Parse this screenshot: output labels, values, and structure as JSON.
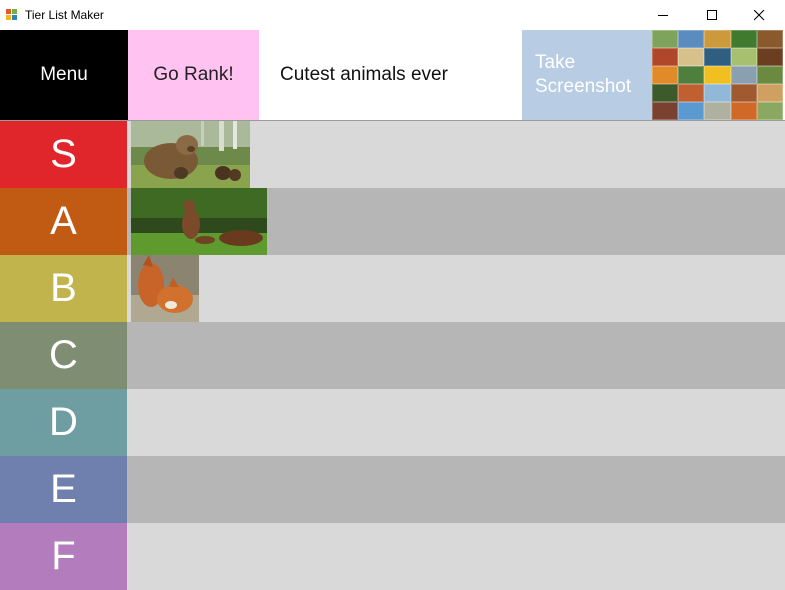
{
  "window": {
    "title": "Tier List Maker",
    "controls": [
      "minimize",
      "maximize",
      "close"
    ]
  },
  "toolbar": {
    "menu_label": "Menu",
    "rank_label": "Go Rank!",
    "list_title": "Cutest animals ever",
    "screenshot_line1": "Take",
    "screenshot_line2": "Screenshot"
  },
  "colors": {
    "menu_bg": "#000000",
    "rank_bg": "#ffc2f1",
    "screenshot_bg": "#b8cce4",
    "row_light": "#d9d9d9",
    "row_dark": "#b6b6b6"
  },
  "tiers": [
    {
      "label": "S",
      "color": "#e0262a",
      "items": [
        "bear-with-cubs-image"
      ]
    },
    {
      "label": "A",
      "color": "#c15a12",
      "items": [
        "squirrel-image"
      ]
    },
    {
      "label": "B",
      "color": "#c2b44c",
      "items": [
        "foxes-image"
      ]
    },
    {
      "label": "C",
      "color": "#7f8e72",
      "items": []
    },
    {
      "label": "D",
      "color": "#6e9ea1",
      "items": []
    },
    {
      "label": "E",
      "color": "#7080ae",
      "items": []
    },
    {
      "label": "F",
      "color": "#b27cbd",
      "items": []
    }
  ]
}
